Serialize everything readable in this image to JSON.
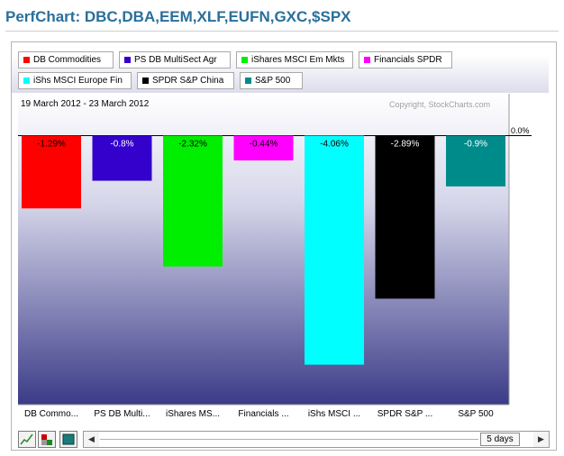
{
  "header": {
    "title": "PerfChart: DBC,DBA,EEM,XLF,EUFN,GXC,$SPX"
  },
  "chart_data": {
    "type": "bar",
    "title": "PerfChart: DBC,DBA,EEM,XLF,EUFN,GXC,$SPX",
    "date_range": "19 March 2012 - 23 March 2012",
    "copyright": "Copyright, StockCharts.com",
    "zero_label": "0.0%",
    "categories": [
      "DB Commo...",
      "PS DB Multi...",
      "iShares MS...",
      "Financials ...",
      "iShs MSCI ...",
      "SPDR S&P ...",
      "S&P 500"
    ],
    "values": [
      -1.29,
      -0.8,
      -2.32,
      -0.44,
      -4.06,
      -2.89,
      -0.9
    ],
    "value_labels": [
      "-1.29%",
      "-0.8%",
      "-2.32%",
      "-0.44%",
      "-4.06%",
      "-2.89%",
      "-0.9%"
    ],
    "colors": [
      "#ff0000",
      "#3300cc",
      "#00ee00",
      "#ff00ff",
      "#00ffff",
      "#000000",
      "#008b8b"
    ],
    "legend": [
      {
        "label": "DB Commodities",
        "color": "#ff0000"
      },
      {
        "label": "PS DB MultiSect  Agr",
        "color": "#3300cc"
      },
      {
        "label": "iShares MSCI Em Mkts",
        "color": "#00ee00"
      },
      {
        "label": "Financials SPDR",
        "color": "#ff00ff"
      },
      {
        "label": "iShs MSCI Europe Fin",
        "color": "#00ffff"
      },
      {
        "label": "SPDR S&P China",
        "color": "#000000"
      },
      {
        "label": "S&P 500",
        "color": "#008b8b"
      }
    ],
    "legend_placement": "top",
    "ylim": [
      -4.8,
      0
    ],
    "grid": false,
    "background_gradient": [
      "#ffffff",
      "#3b3b88"
    ]
  },
  "controls": {
    "period_label": "5 days",
    "scroll_left": "◀",
    "scroll_right": "▶",
    "icons": [
      "line-chart-icon",
      "perf-mode-icon",
      "bar-chart-icon"
    ]
  }
}
